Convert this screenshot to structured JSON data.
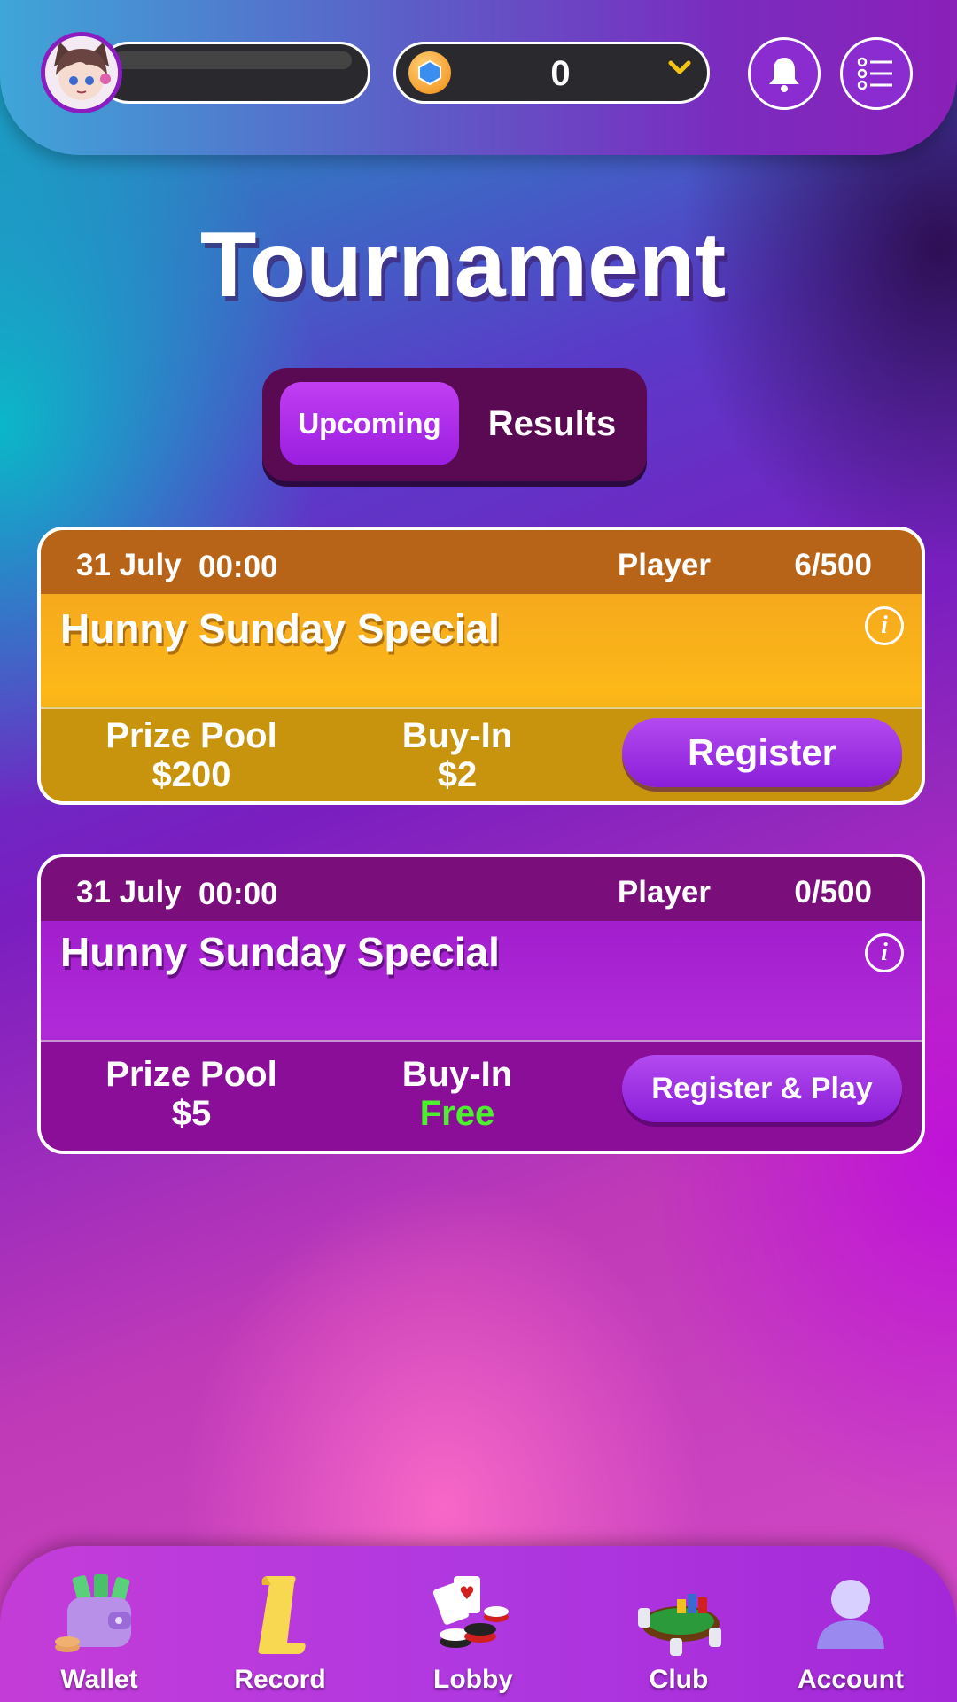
{
  "header": {
    "coin_balance": "0",
    "icons": [
      "avatar",
      "hexagon-coin-icon",
      "chevron-down-icon",
      "bell-icon",
      "menu-list-icon"
    ]
  },
  "page": {
    "title": "Tournament"
  },
  "tabs": {
    "active": "Upcoming",
    "inactive": "Results"
  },
  "tournaments": [
    {
      "date": "31 July",
      "time": "00:00",
      "player_label": "Player",
      "player_count": "6/500",
      "name": "Hunny Sunday Special",
      "prize_label": "Prize Pool",
      "prize_value": "$200",
      "buyin_label": "Buy-In",
      "buyin_value": "$2",
      "button": "Register"
    },
    {
      "date": "31 July",
      "time": "00:00",
      "player_label": "Player",
      "player_count": "0/500",
      "name": "Hunny Sunday Special",
      "prize_label": "Prize Pool",
      "prize_value": "$5",
      "buyin_label": "Buy-In",
      "buyin_value": "Free",
      "button": "Register & Play"
    }
  ],
  "nav": {
    "items": [
      {
        "label": "Wallet",
        "icon": "wallet-icon"
      },
      {
        "label": "Record",
        "icon": "scroll-icon"
      },
      {
        "label": "Lobby",
        "icon": "cards-chips-icon"
      },
      {
        "label": "Club",
        "icon": "poker-table-icon"
      },
      {
        "label": "Account",
        "icon": "user-icon"
      }
    ]
  },
  "colors": {
    "accent_purple": "#9a1ee0",
    "card_orange": "#fdb818",
    "free_green": "#4cf02e"
  }
}
